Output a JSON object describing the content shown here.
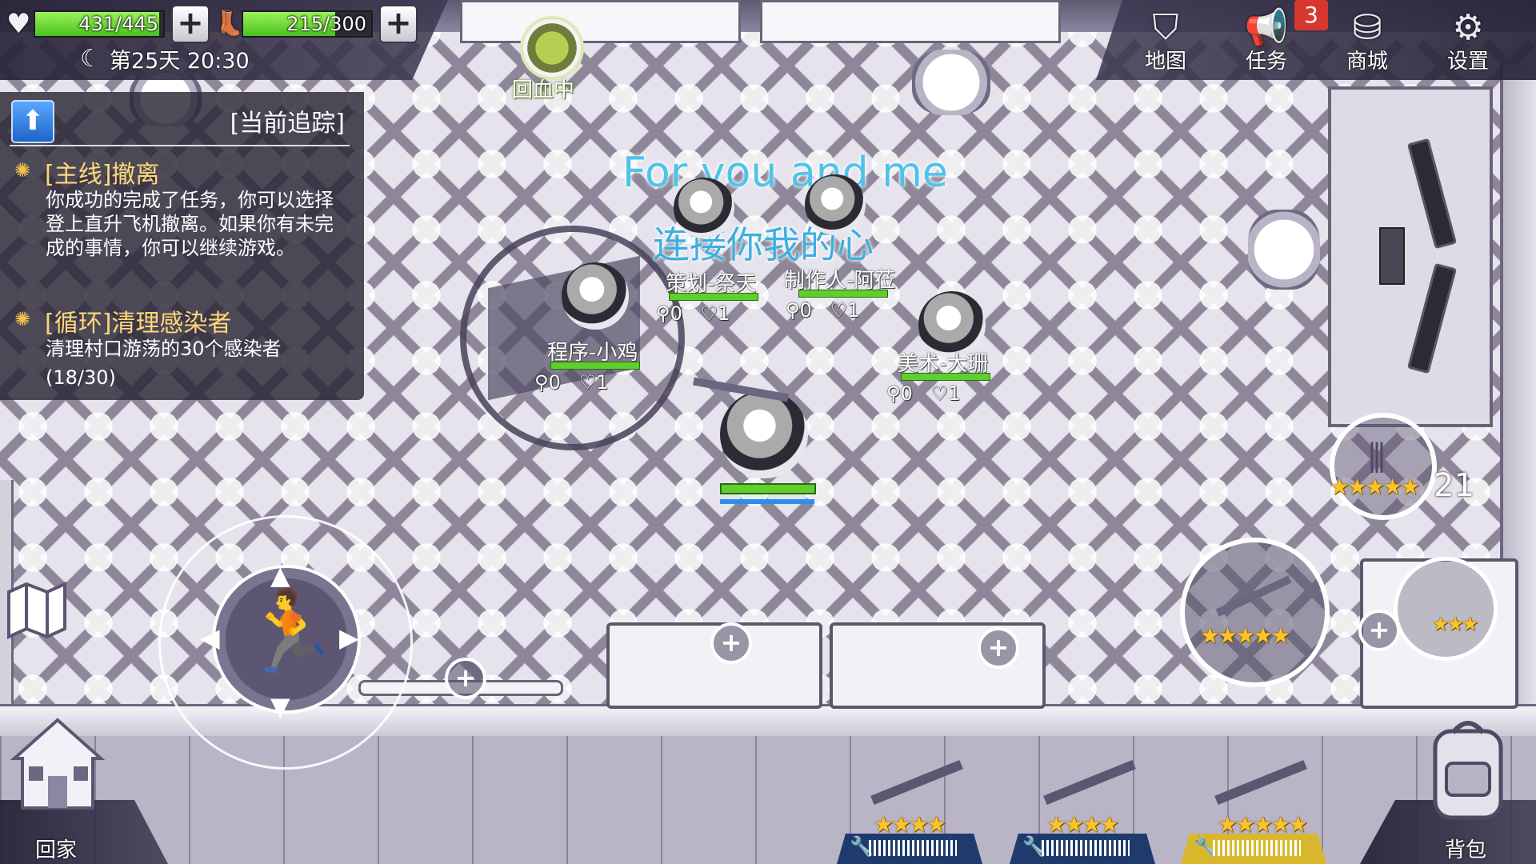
{
  "status": {
    "health_value": "431/445",
    "health_fraction": 0.9685,
    "stamina_value": "215/300",
    "stamina_fraction": 0.7167,
    "day_time": "第25天 20:30"
  },
  "heal_indicator": {
    "label": "回血中"
  },
  "quest_panel": {
    "tracking_label": "[当前追踪]",
    "quests": [
      {
        "title": "[主线]撤离",
        "desc": "你成功的完成了任务，你可以选择登上直升飞机撤离。如果你有未完成的事情，你可以继续游戏。"
      },
      {
        "title": "[循环]清理感染者",
        "desc": "清理村口游荡的30个感染者",
        "progress": "(18/30)"
      }
    ]
  },
  "menu": {
    "map": "地图",
    "tasks": "任务",
    "tasks_badge": "3",
    "shop": "商城",
    "settings": "设置"
  },
  "overlay_text": {
    "line1": "For you and me",
    "line2": "连接你我的心"
  },
  "players": [
    {
      "name": "策划-祭天",
      "kills": "0",
      "likes": "1"
    },
    {
      "name": "制作人-阿莅",
      "kills": "0",
      "likes": "1"
    },
    {
      "name": "程序-小鸡",
      "kills": "0",
      "likes": "1"
    },
    {
      "name": "美术-大珊",
      "kills": "0",
      "likes": "1"
    }
  ],
  "weapon": {
    "main_stars": "★★★★★",
    "ammo_stars": "★★★★★",
    "ammo_count": "21",
    "equip_stars": "★★★"
  },
  "hotbar": [
    {
      "stars": "★★★★",
      "color": "#1f3b6e"
    },
    {
      "stars": "★★★★",
      "color": "#1f3b6e"
    },
    {
      "stars": "★★★★★",
      "color": "#d9b72c"
    }
  ],
  "bottom": {
    "home": "回家",
    "bag": "背包"
  },
  "icons": {
    "heart": "heart-icon",
    "stamina": "boot-icon",
    "moon": "moon-icon",
    "map": "map-icon",
    "tasks": "megaphone-icon",
    "shop": "coins-icon",
    "settings": "gear-icon"
  }
}
